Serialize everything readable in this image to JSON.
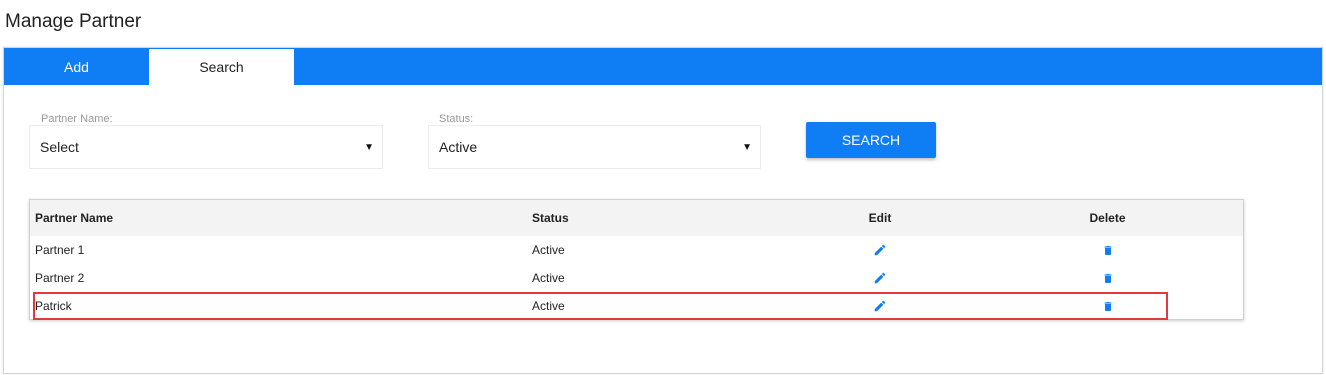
{
  "page": {
    "title": "Manage Partner"
  },
  "tabs": {
    "add_label": "Add",
    "search_label": "Search"
  },
  "filters": {
    "partner_name": {
      "label": "Partner Name:",
      "value": "Select"
    },
    "status": {
      "label": "Status:",
      "value": "Active"
    },
    "search_button": "SEARCH"
  },
  "table": {
    "headers": {
      "name": "Partner Name",
      "status": "Status",
      "edit": "Edit",
      "delete": "Delete"
    },
    "rows": [
      {
        "name": "Partner 1",
        "status": "Active"
      },
      {
        "name": "Partner 2",
        "status": "Active"
      },
      {
        "name": "Patrick",
        "status": "Active"
      }
    ]
  },
  "icons": {
    "edit": "pencil-icon",
    "delete": "trash-icon"
  },
  "colors": {
    "accent": "#0f7ef5",
    "highlight": "#e03a3a"
  }
}
